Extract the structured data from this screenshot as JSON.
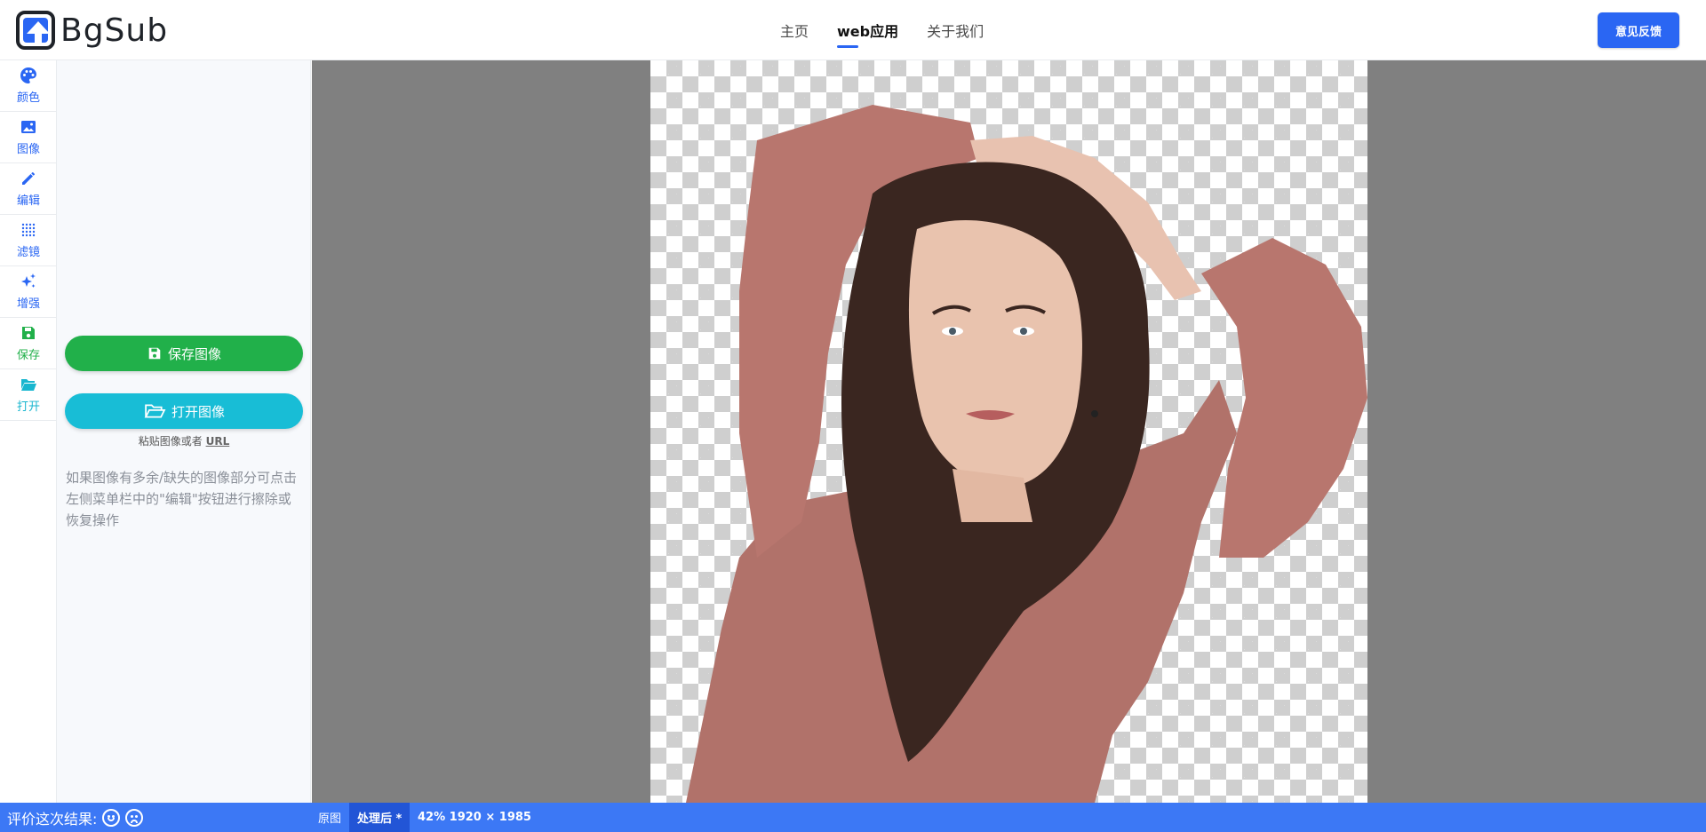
{
  "brand": {
    "name": "BgSub"
  },
  "nav": [
    {
      "label": "主页",
      "active": false
    },
    {
      "label": "web应用",
      "active": true
    },
    {
      "label": "关于我们",
      "active": false
    }
  ],
  "feedback_label": "意见反馈",
  "rail": [
    {
      "label": "颜色",
      "icon": "palette-icon"
    },
    {
      "label": "图像",
      "icon": "image-icon"
    },
    {
      "label": "编辑",
      "icon": "pencil-icon"
    },
    {
      "label": "滤镜",
      "icon": "dots-grid-icon"
    },
    {
      "label": "增强",
      "icon": "sparkle-icon"
    },
    {
      "label": "保存",
      "icon": "floppy-icon"
    },
    {
      "label": "打开",
      "icon": "folder-open-icon"
    }
  ],
  "panel": {
    "save_label": "保存图像",
    "open_label": "打开图像",
    "paste_prefix": "粘贴图像或者",
    "paste_url": "URL",
    "hint": "如果图像有多余/缺失的图像部分可点击左侧菜单栏中的\"编辑\"按钮进行擦除或恢复操作"
  },
  "statusbar": {
    "rate_label": "评价这次结果:",
    "tab_original": "原图",
    "tab_processed": "处理后 *",
    "zoom_info": "42% 1920 × 1985"
  },
  "colors": {
    "accent": "#2a66f3",
    "save_green": "#21b04a",
    "open_cyan": "#18bdd6",
    "statusbar": "#3c78f5",
    "canvas_bg": "#808080"
  }
}
